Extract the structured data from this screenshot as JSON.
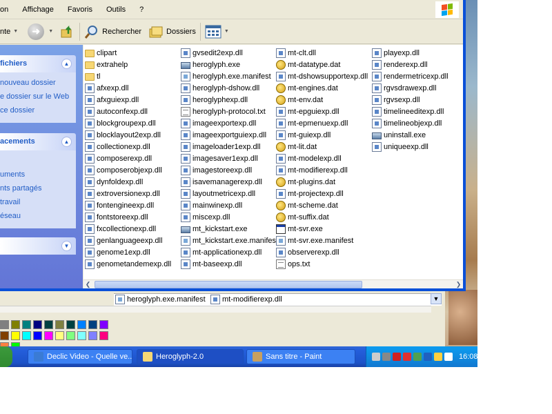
{
  "menu": [
    "on",
    "Affichage",
    "Favoris",
    "Outils",
    "?"
  ],
  "toolbar": {
    "back_partial": "nte",
    "search_label": "Rechercher",
    "folders_label": "Dossiers"
  },
  "taskpane": {
    "files_section": {
      "title": "fichiers",
      "links": [
        "nouveau dossier",
        "e dossier sur le Web",
        "ce dossier"
      ]
    },
    "places_section": {
      "title": "acements",
      "links": [
        "uments",
        "nts partagés",
        "travail",
        "éseau"
      ]
    }
  },
  "files": {
    "col1": [
      {
        "name": "clipart",
        "type": "folder"
      },
      {
        "name": "extrahelp",
        "type": "folder"
      },
      {
        "name": "tl",
        "type": "folder"
      },
      {
        "name": "afxexp.dll",
        "type": "dll"
      },
      {
        "name": "afxguiexp.dll",
        "type": "dll"
      },
      {
        "name": "autoconfexp.dll",
        "type": "dll"
      },
      {
        "name": "blockgroupexp.dll",
        "type": "dll"
      },
      {
        "name": "blocklayout2exp.dll",
        "type": "dll"
      },
      {
        "name": "collectionexp.dll",
        "type": "dll"
      },
      {
        "name": "composerexp.dll",
        "type": "dll"
      },
      {
        "name": "composerobjexp.dll",
        "type": "dll"
      },
      {
        "name": "dynfoldexp.dll",
        "type": "dll"
      },
      {
        "name": "extroversionexp.dll",
        "type": "dll"
      },
      {
        "name": "fontengineexp.dll",
        "type": "dll"
      },
      {
        "name": "fontstoreexp.dll",
        "type": "dll"
      },
      {
        "name": "fxcollectionexp.dll",
        "type": "dll"
      },
      {
        "name": "genlanguageexp.dll",
        "type": "dll"
      },
      {
        "name": "genome1exp.dll",
        "type": "dll"
      },
      {
        "name": "genometandemexp.dll",
        "type": "dll"
      }
    ],
    "col2": [
      {
        "name": "gvsedit2exp.dll",
        "type": "dll"
      },
      {
        "name": "heroglyph.exe",
        "type": "exe"
      },
      {
        "name": "heroglyph.exe.manifest",
        "type": "manifest"
      },
      {
        "name": "heroglyph-dshow.dll",
        "type": "dll"
      },
      {
        "name": "heroglyphexp.dll",
        "type": "dll"
      },
      {
        "name": "heroglyph-protocol.txt",
        "type": "txt"
      },
      {
        "name": "imageexportexp.dll",
        "type": "dll"
      },
      {
        "name": "imageexportguiexp.dll",
        "type": "dll"
      },
      {
        "name": "imageloader1exp.dll",
        "type": "dll"
      },
      {
        "name": "imagesaver1exp.dll",
        "type": "dll"
      },
      {
        "name": "imagestoreexp.dll",
        "type": "dll"
      },
      {
        "name": "isavemanagerexp.dll",
        "type": "dll"
      },
      {
        "name": "layoutmetricexp.dll",
        "type": "dll"
      },
      {
        "name": "mainwinexp.dll",
        "type": "dll"
      },
      {
        "name": "miscexp.dll",
        "type": "dll"
      },
      {
        "name": "mt_kickstart.exe",
        "type": "exe"
      },
      {
        "name": "mt_kickstart.exe.manifest",
        "type": "manifest"
      },
      {
        "name": "mt-applicationexp.dll",
        "type": "dll"
      },
      {
        "name": "mt-baseexp.dll",
        "type": "dll"
      }
    ],
    "col3": [
      {
        "name": "mt-clt.dll",
        "type": "dll"
      },
      {
        "name": "mt-datatype.dat",
        "type": "dat"
      },
      {
        "name": "mt-dshowsupportexp.dll",
        "type": "dll"
      },
      {
        "name": "mt-engines.dat",
        "type": "dat"
      },
      {
        "name": "mt-env.dat",
        "type": "dat"
      },
      {
        "name": "mt-epguiexp.dll",
        "type": "dll"
      },
      {
        "name": "mt-epmenuexp.dll",
        "type": "dll"
      },
      {
        "name": "mt-guiexp.dll",
        "type": "dll"
      },
      {
        "name": "mt-lit.dat",
        "type": "dat"
      },
      {
        "name": "mt-modelexp.dll",
        "type": "dll"
      },
      {
        "name": "mt-modifierexp.dll",
        "type": "dll"
      },
      {
        "name": "mt-plugins.dat",
        "type": "dat"
      },
      {
        "name": "mt-projectexp.dll",
        "type": "dll"
      },
      {
        "name": "mt-scheme.dat",
        "type": "dat"
      },
      {
        "name": "mt-suffix.dat",
        "type": "dat"
      },
      {
        "name": "mt-svr.exe",
        "type": "wexe"
      },
      {
        "name": "mt-svr.exe.manifest",
        "type": "manifest"
      },
      {
        "name": "observerexp.dll",
        "type": "dll"
      },
      {
        "name": "ops.txt",
        "type": "txt"
      }
    ],
    "col4": [
      {
        "name": "playexp.dll",
        "type": "dll"
      },
      {
        "name": "renderexp.dll",
        "type": "dll"
      },
      {
        "name": "rendermetricexp.dll",
        "type": "dll"
      },
      {
        "name": "rgvsdrawexp.dll",
        "type": "dll"
      },
      {
        "name": "rgvsexp.dll",
        "type": "dll"
      },
      {
        "name": "timelineeditexp.dll",
        "type": "dll"
      },
      {
        "name": "timelineobjexp.dll",
        "type": "dll"
      },
      {
        "name": "uninstall.exe",
        "type": "exe"
      },
      {
        "name": "uniqueexp.dll",
        "type": "dll"
      }
    ]
  },
  "paint_window": {
    "visible_files": [
      "heroglyph.exe.manifest",
      "mt-modifierexp.dll"
    ]
  },
  "palette": [
    "#808080",
    "#808000",
    "#008080",
    "#000080",
    "#004040",
    "#808040",
    "#004040",
    "#0080ff",
    "#004080",
    "#8000ff",
    "#804000",
    "#ffff00",
    "#00ffff",
    "#0000ff",
    "#ff00ff",
    "#ffff80",
    "#80ff80",
    "#80ffff",
    "#8080ff",
    "#ff0080",
    "#ff8040",
    "#00ff00"
  ],
  "taskbar": {
    "tasks": [
      {
        "label": "Declic Video - Quelle ve...",
        "active": false,
        "icon_color": "#3a7bd5"
      },
      {
        "label": "Heroglyph-2.0",
        "active": true,
        "icon_color": "#f7d774"
      },
      {
        "label": "Sans titre - Paint",
        "active": false,
        "icon_color": "#c8a060"
      }
    ],
    "clock": "16:08",
    "tray_icon_colors": [
      "#cccccc",
      "#888888",
      "#d02020",
      "#e03030",
      "#50a050",
      "#2060c0",
      "#ffd040",
      "#ffffff"
    ]
  }
}
